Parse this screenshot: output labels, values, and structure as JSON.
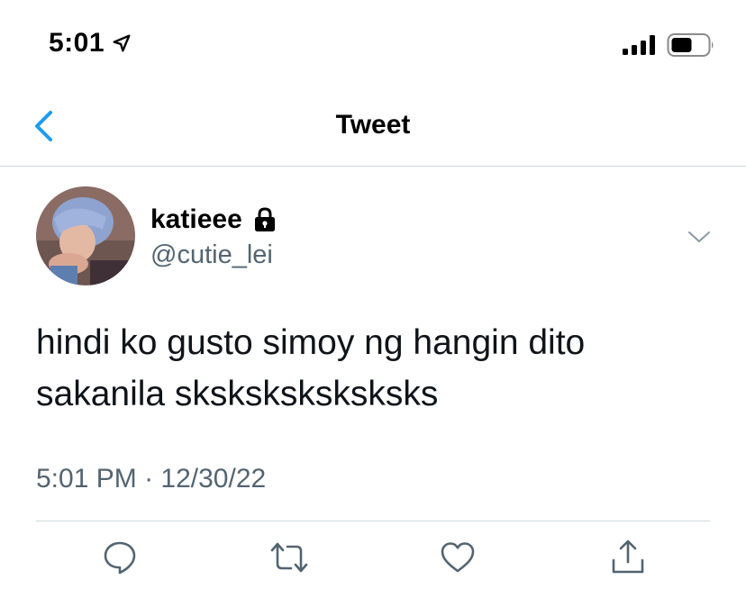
{
  "status_bar": {
    "time": "5:01",
    "icons": [
      "location-arrow-icon",
      "signal-icon",
      "battery-icon"
    ]
  },
  "nav": {
    "back_icon": "chevron-left-icon",
    "title": "Tweet"
  },
  "tweet": {
    "author": {
      "display_name": "katieee",
      "handle": "@cutie_lei",
      "protected_icon": "lock-icon",
      "avatar_icon": "profile-photo"
    },
    "text_lines": [
      "hindi ko gusto simoy ng hangin dito",
      "sakanila sksksksksksksks"
    ],
    "time": "5:01 PM",
    "separator": "·",
    "date": "12/30/22",
    "menu_icon": "chevron-down-icon"
  },
  "actions": [
    {
      "icon": "reply-icon"
    },
    {
      "icon": "retweet-icon"
    },
    {
      "icon": "like-icon"
    },
    {
      "icon": "share-icon"
    }
  ],
  "colors": {
    "accent": "#1d9bf0",
    "secondary_text": "#536471",
    "divider": "#cfd9de"
  }
}
